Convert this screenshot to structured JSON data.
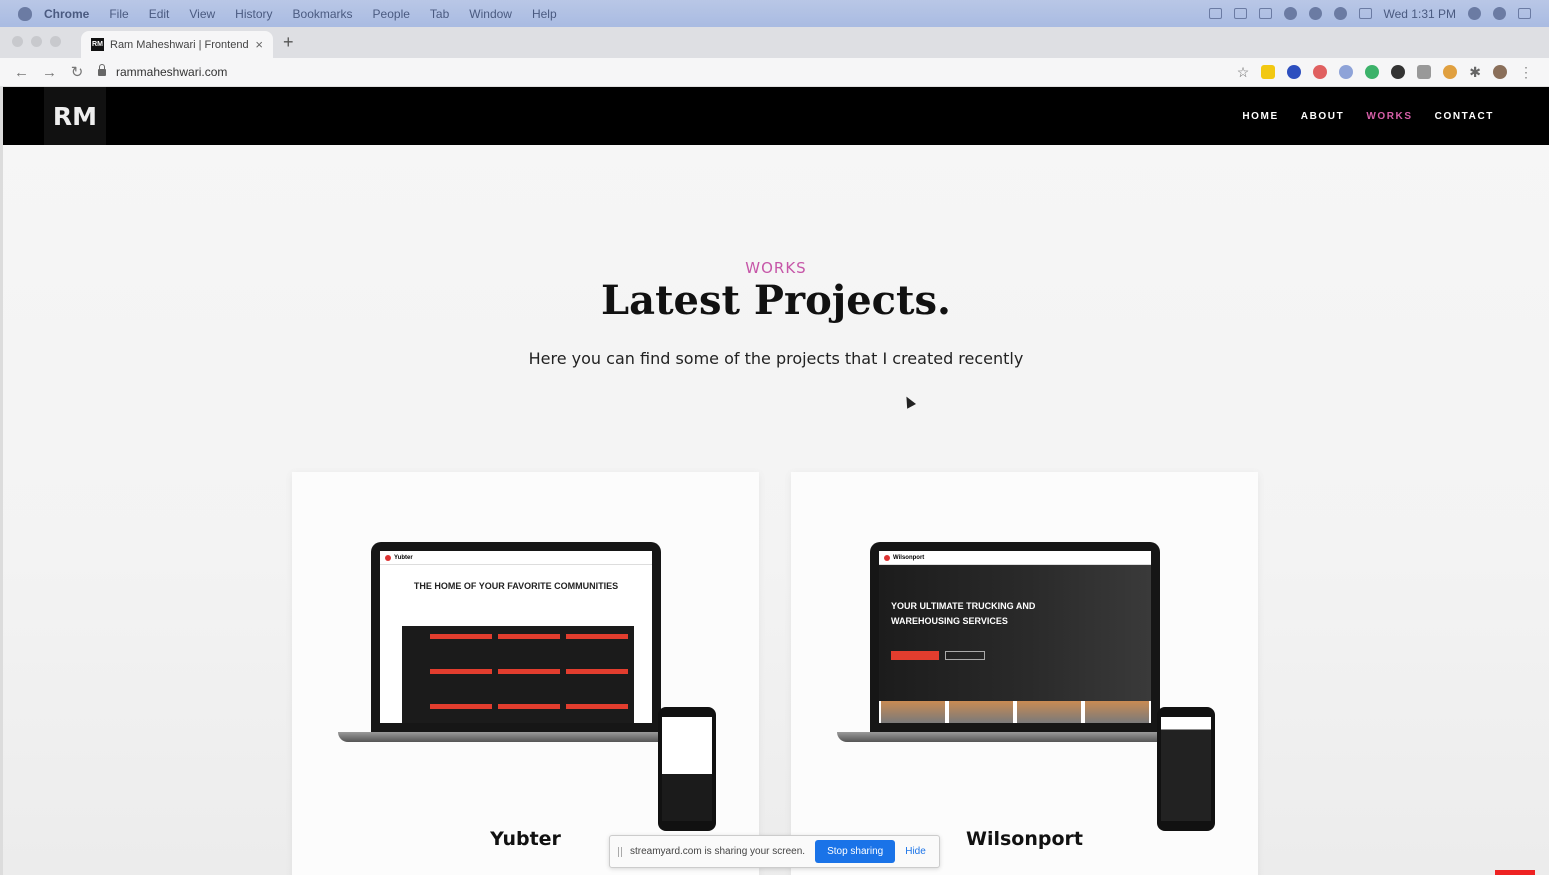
{
  "menubar": {
    "app": "Chrome",
    "items": [
      "File",
      "Edit",
      "View",
      "History",
      "Bookmarks",
      "People",
      "Tab",
      "Window",
      "Help"
    ],
    "clock": "Wed 1:31 PM"
  },
  "browser": {
    "tab_title": "Ram Maheshwari | Frontend W",
    "favicon_text": "RM",
    "new_tab": "+",
    "close": "×",
    "url": "rammaheshwari.com"
  },
  "site": {
    "logo": "RM",
    "nav": [
      "HOME",
      "ABOUT",
      "WORKS",
      "CONTACT"
    ],
    "active_nav": "WORKS",
    "section_label": "WORKS",
    "section_title": "Latest Projects.",
    "section_subtitle": "Here you can find some of the projects that I created recently",
    "projects": [
      {
        "name": "Yubter",
        "brand": "Yubter",
        "headline": "THE HOME OF YOUR FAVORITE COMMUNITIES"
      },
      {
        "name": "Wilsonport",
        "brand": "Wilsonport",
        "headline_line1": "YOUR ULTIMATE TRUCKING AND",
        "headline_line2": "WAREHOUSING SERVICES"
      }
    ]
  },
  "share_bar": {
    "message": "streamyard.com is sharing your screen.",
    "stop": "Stop sharing",
    "hide": "Hide"
  },
  "colors": {
    "accent": "#c656a8",
    "nav_bg": "#000000",
    "share_button": "#1a73e8"
  }
}
